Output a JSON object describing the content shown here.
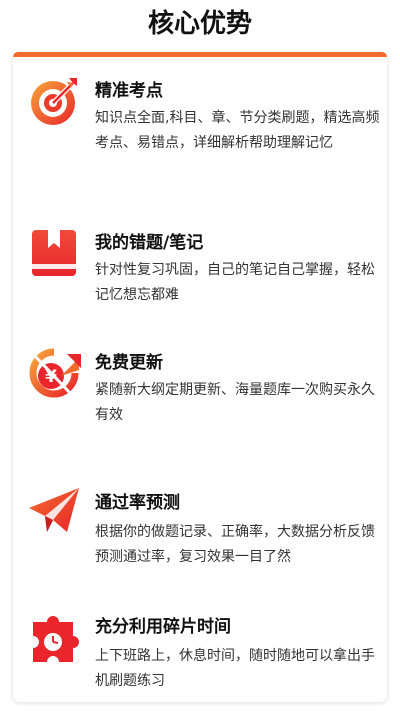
{
  "page": {
    "title": "核心优势"
  },
  "features": [
    {
      "title": "精准考点",
      "desc": "知识点全面,科目、章、节分类刷题，精选高频考点、易错点，详细解析帮助理解记忆",
      "icon": "target-icon"
    },
    {
      "title": "我的错题/笔记",
      "desc": "针对性复习巩固，自己的笔记自己掌握，轻松记忆想忘都难",
      "icon": "book-icon"
    },
    {
      "title": "免费更新",
      "desc": "紧随新大纲定期更新、海量题库一次购买永久有效",
      "icon": "free-update-icon"
    },
    {
      "title": "通过率预测",
      "desc": "根据你的做题记录、正确率，大数据分析反馈预测通过率，复习效果一目了然",
      "icon": "paper-plane-icon"
    },
    {
      "title": "充分利用碎片时间",
      "desc": "上下班路上，休息时间，随时随地可以拿出手机刷题练习",
      "icon": "puzzle-clock-icon"
    }
  ],
  "colors": {
    "accent": "#f26a2c",
    "accent_red": "#e8262b"
  }
}
